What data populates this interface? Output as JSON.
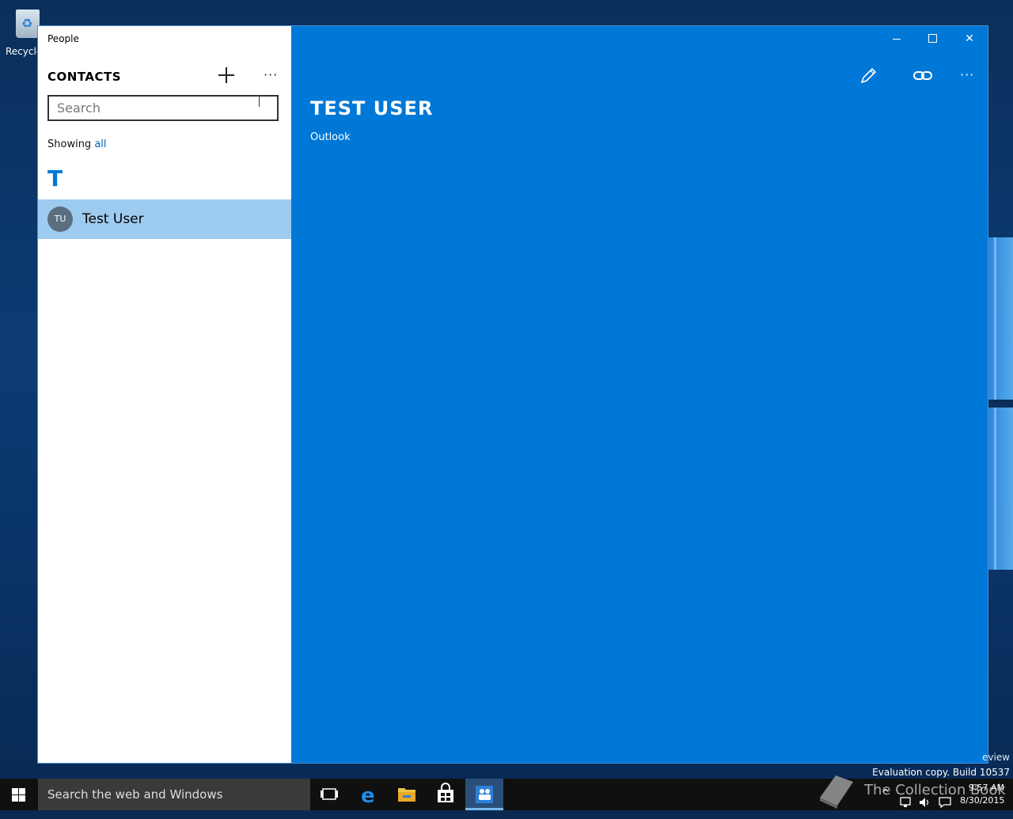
{
  "desktop": {
    "recycle_bin_label": "Recycle",
    "watermark_line1": "eview",
    "watermark_line2": "Evaluation copy. Build 10537"
  },
  "window": {
    "app_title": "People",
    "sidebar": {
      "heading": "CONTACTS",
      "search_placeholder": "Search",
      "showing_prefix": "Showing",
      "showing_filter": "all",
      "group_letter": "T",
      "contacts": [
        {
          "initials": "TU",
          "name": "Test User"
        }
      ]
    },
    "detail": {
      "title": "TEST USER",
      "source": "Outlook"
    }
  },
  "taskbar": {
    "search_text": "Search the web and Windows",
    "overlay_text": "The Collection Book",
    "time": "9:57 AM",
    "date": "8/30/2015"
  },
  "icons": {
    "add": "plus-icon",
    "more": "more-icon",
    "edit": "pencil-icon",
    "link": "link-icon",
    "minimize": "minimize-icon",
    "maximize": "maximize-icon",
    "close": "close-icon"
  },
  "colors": {
    "accent": "#0078d7",
    "selected_row": "#9ecbf0",
    "avatar": "#5a6e80",
    "taskbar": "#101010",
    "taskbar_search": "#3a3a3a"
  }
}
